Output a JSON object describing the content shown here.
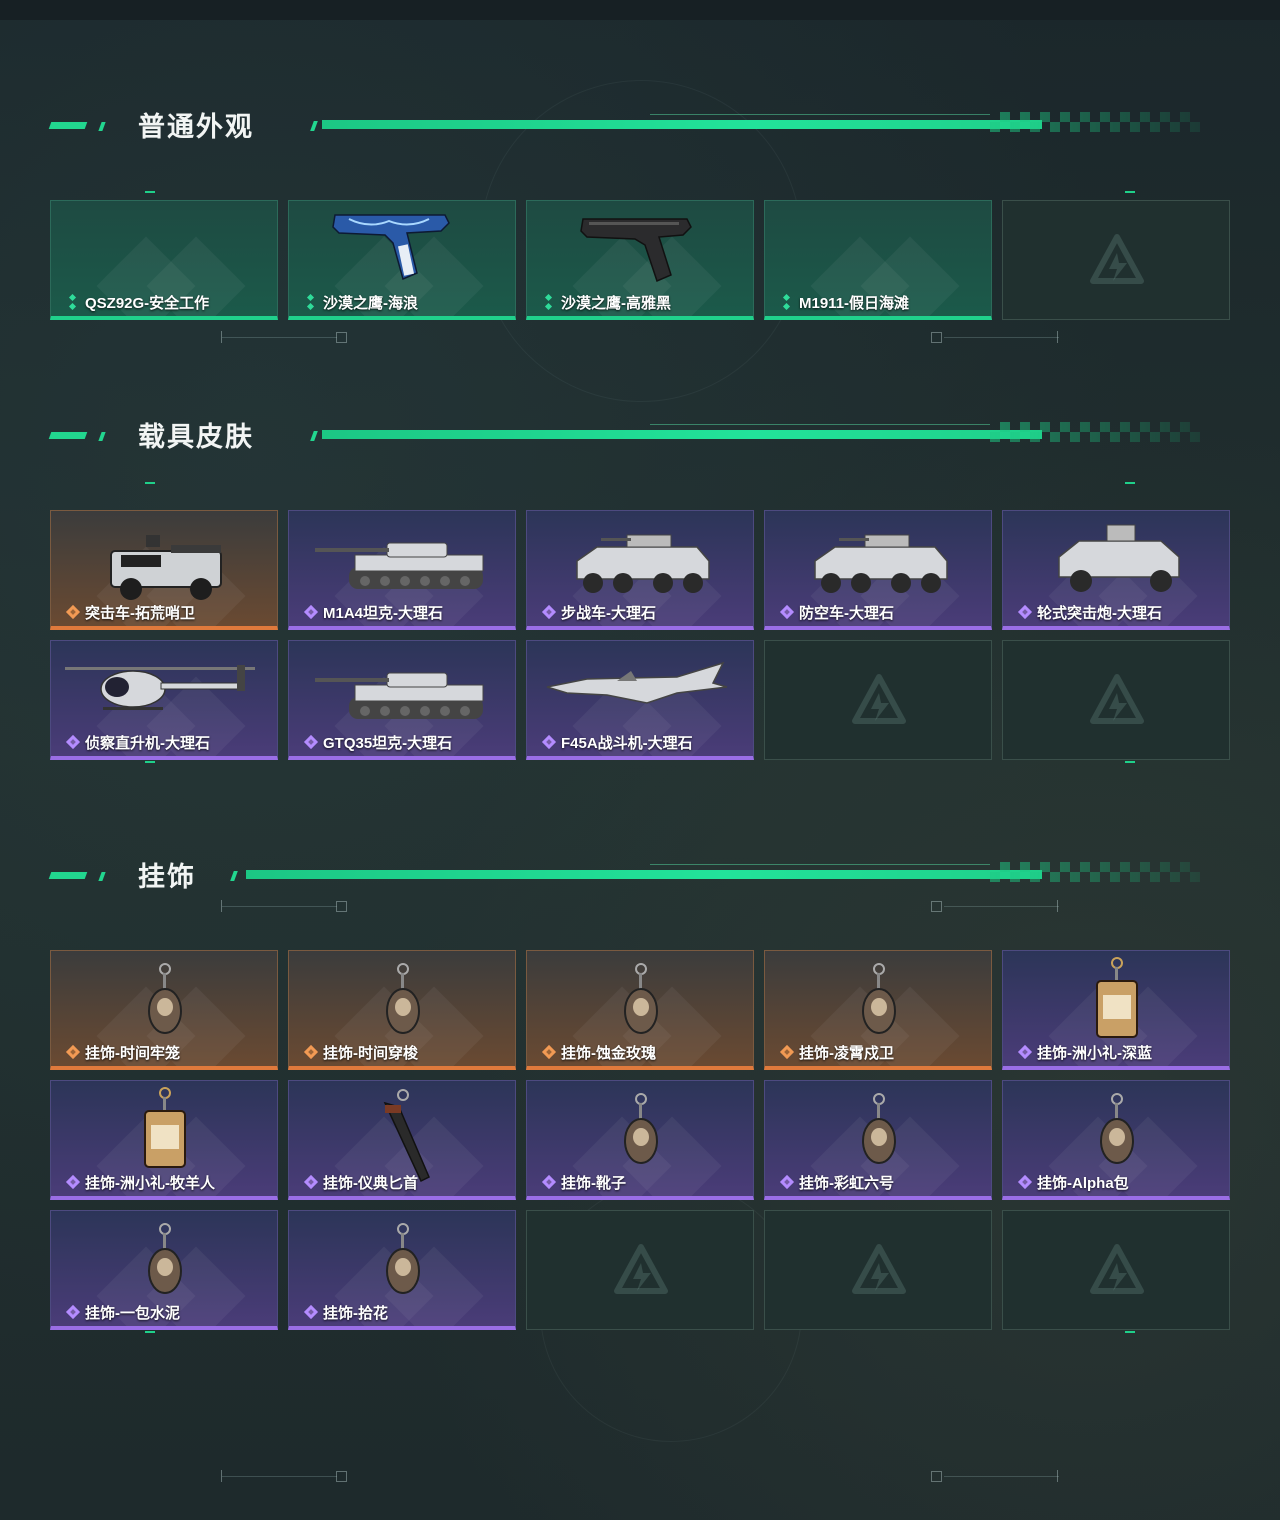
{
  "sections": [
    {
      "title": "普通外观",
      "items": [
        {
          "name": "QSZ92G-安全工作",
          "rarity": "green",
          "art": "none"
        },
        {
          "name": "沙漠之鹰-海浪",
          "rarity": "green",
          "art": "pistol-blue"
        },
        {
          "name": "沙漠之鹰-高雅黑",
          "rarity": "green",
          "art": "pistol-black"
        },
        {
          "name": "M1911-假日海滩",
          "rarity": "green",
          "art": "none"
        },
        {
          "name": "",
          "rarity": "empty",
          "art": "none"
        }
      ]
    },
    {
      "title": "载具皮肤",
      "items": [
        {
          "name": "突击车-拓荒哨卫",
          "rarity": "orange",
          "art": "assault-vehicle"
        },
        {
          "name": "M1A4坦克-大理石",
          "rarity": "purple",
          "art": "tank"
        },
        {
          "name": "步战车-大理石",
          "rarity": "purple",
          "art": "ifv"
        },
        {
          "name": "防空车-大理石",
          "rarity": "purple",
          "art": "ifv"
        },
        {
          "name": "轮式突击炮-大理石",
          "rarity": "purple",
          "art": "wheeled-gun"
        },
        {
          "name": "侦察直升机-大理石",
          "rarity": "purple",
          "art": "helicopter"
        },
        {
          "name": "GTQ35坦克-大理石",
          "rarity": "purple",
          "art": "tank"
        },
        {
          "name": "F45A战斗机-大理石",
          "rarity": "purple",
          "art": "jet"
        },
        {
          "name": "",
          "rarity": "empty",
          "art": "none"
        },
        {
          "name": "",
          "rarity": "empty",
          "art": "none"
        }
      ]
    },
    {
      "title": "挂饰",
      "items": [
        {
          "name": "挂饰-时间牢笼",
          "rarity": "orange",
          "art": "charm"
        },
        {
          "name": "挂饰-时间穿梭",
          "rarity": "orange",
          "art": "charm"
        },
        {
          "name": "挂饰-蚀金玫瑰",
          "rarity": "orange",
          "art": "charm"
        },
        {
          "name": "挂饰-凌霄戍卫",
          "rarity": "orange",
          "art": "charm"
        },
        {
          "name": "挂饰-洲小礼-深蓝",
          "rarity": "purple",
          "art": "charm-box"
        },
        {
          "name": "挂饰-洲小礼-牧羊人",
          "rarity": "purple",
          "art": "charm-box"
        },
        {
          "name": "挂饰-仪典匕首",
          "rarity": "purple",
          "art": "charm-knife"
        },
        {
          "name": "挂饰-靴子",
          "rarity": "purple",
          "art": "charm"
        },
        {
          "name": "挂饰-彩虹六号",
          "rarity": "purple",
          "art": "charm"
        },
        {
          "name": "挂饰-Alpha包",
          "rarity": "purple",
          "art": "charm"
        },
        {
          "name": "挂饰-一包水泥",
          "rarity": "purple",
          "art": "charm"
        },
        {
          "name": "挂饰-拾花",
          "rarity": "purple",
          "art": "charm"
        },
        {
          "name": "",
          "rarity": "empty",
          "art": "none"
        },
        {
          "name": "",
          "rarity": "empty",
          "art": "none"
        },
        {
          "name": "",
          "rarity": "empty",
          "art": "none"
        }
      ]
    }
  ],
  "colors": {
    "green": "#20d08c",
    "purple": "#9a6ee6",
    "orange": "#e07a3c"
  }
}
